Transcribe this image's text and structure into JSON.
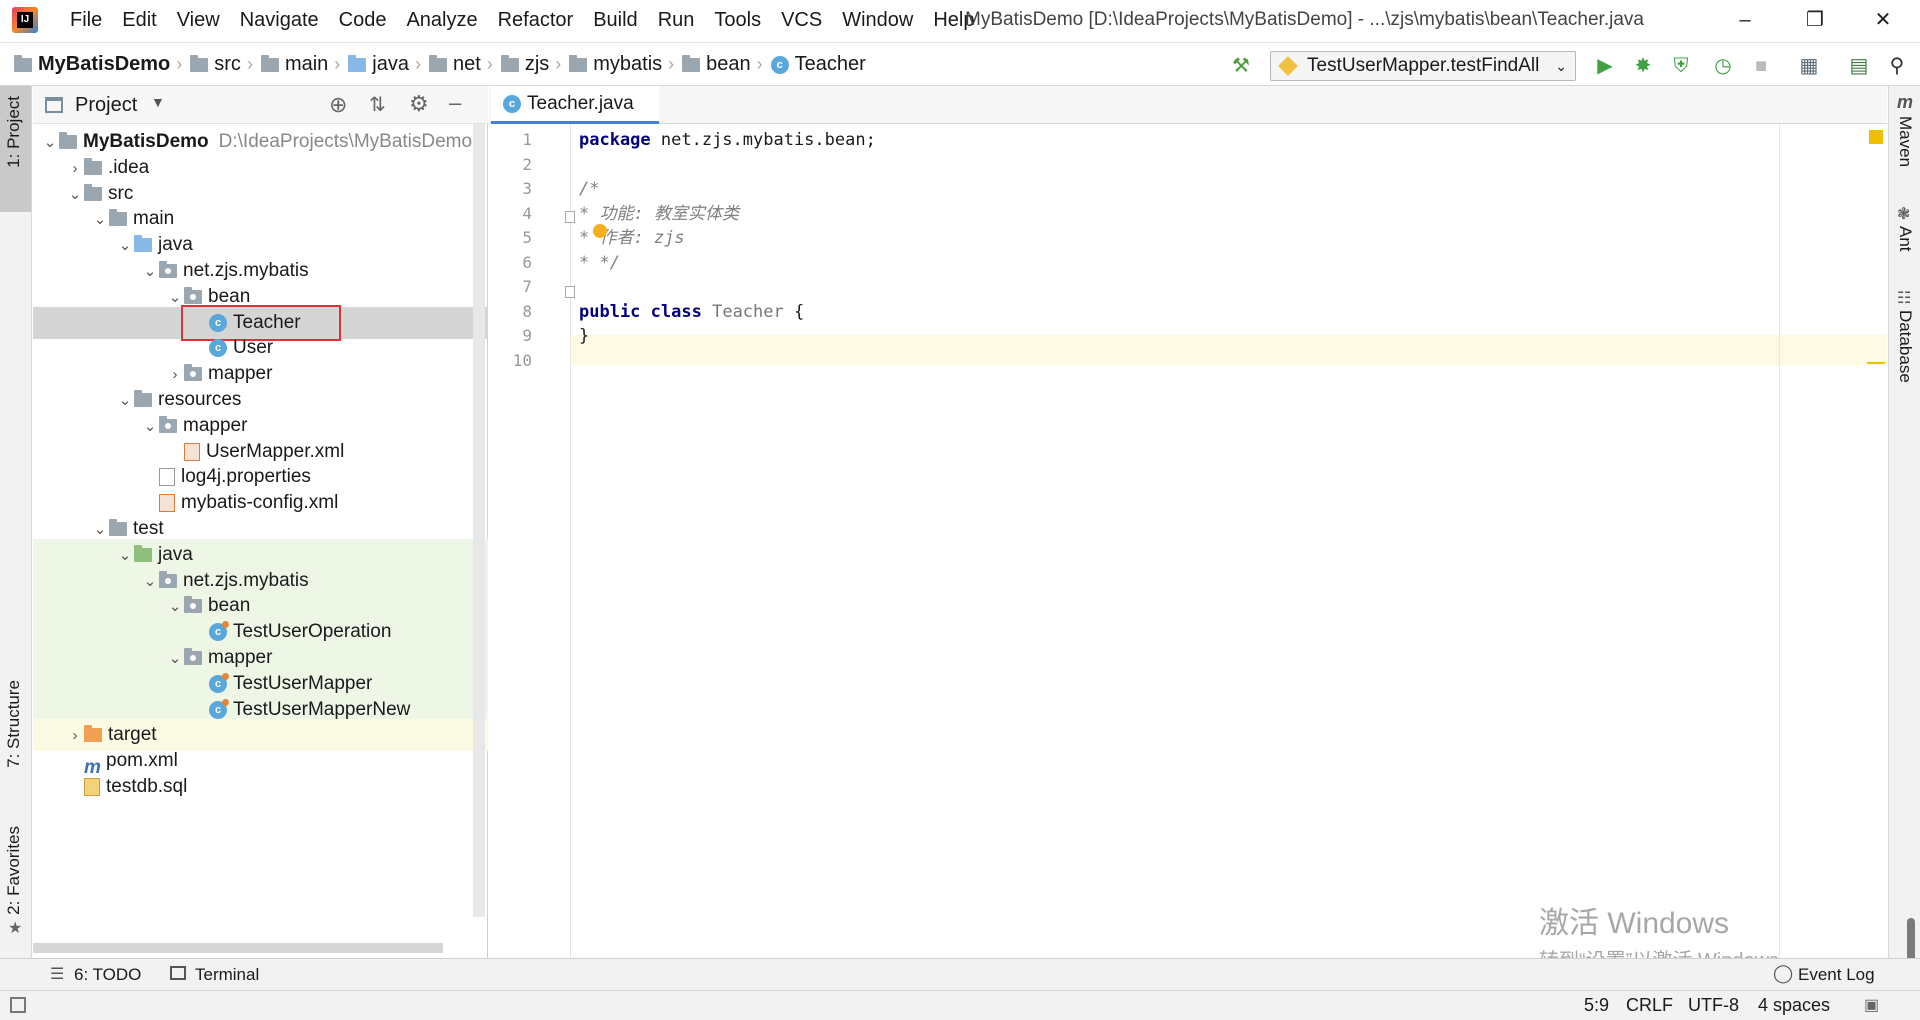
{
  "window": {
    "title": "MyBatisDemo [D:\\IdeaProjects\\MyBatisDemo] - ...\\zjs\\mybatis\\bean\\Teacher.java",
    "menu": [
      "File",
      "Edit",
      "View",
      "Navigate",
      "Code",
      "Analyze",
      "Refactor",
      "Build",
      "Run",
      "Tools",
      "VCS",
      "Window",
      "Help"
    ]
  },
  "breadcrumb": [
    "MyBatisDemo",
    "src",
    "main",
    "java",
    "net",
    "zjs",
    "mybatis",
    "bean",
    "Teacher"
  ],
  "run_config": "TestUserMapper.testFindAll",
  "left_tabs": [
    "1: Project",
    "7: Structure",
    "2: Favorites"
  ],
  "right_tabs": [
    "Maven",
    "Ant",
    "Database"
  ],
  "project_panel": {
    "title": "Project",
    "tree": [
      {
        "label": "MyBatisDemo",
        "extra": "D:\\IdeaProjects\\MyBatisDemo",
        "depth": 0,
        "arrow": "down",
        "icon": "project-folder-icon"
      },
      {
        "label": ".idea",
        "depth": 1,
        "arrow": "right",
        "icon": "folder-icon"
      },
      {
        "label": "src",
        "depth": 1,
        "arrow": "down",
        "icon": "folder-icon"
      },
      {
        "label": "main",
        "depth": 2,
        "arrow": "down",
        "icon": "folder-icon"
      },
      {
        "label": "java",
        "depth": 3,
        "arrow": "down",
        "icon": "source-folder-icon"
      },
      {
        "label": "net.zjs.mybatis",
        "depth": 4,
        "arrow": "down",
        "icon": "package-icon"
      },
      {
        "label": "bean",
        "depth": 5,
        "arrow": "down",
        "icon": "package-icon"
      },
      {
        "label": "Teacher",
        "depth": 6,
        "arrow": "",
        "icon": "class-icon",
        "selected": true
      },
      {
        "label": "User",
        "depth": 6,
        "arrow": "",
        "icon": "class-icon"
      },
      {
        "label": "mapper",
        "depth": 5,
        "arrow": "right",
        "icon": "package-icon"
      },
      {
        "label": "resources",
        "depth": 3,
        "arrow": "down",
        "icon": "resources-folder-icon"
      },
      {
        "label": "mapper",
        "depth": 4,
        "arrow": "down",
        "icon": "package-icon"
      },
      {
        "label": "UserMapper.xml",
        "depth": 5,
        "arrow": "",
        "icon": "xml-file-icon"
      },
      {
        "label": "log4j.properties",
        "depth": 4,
        "arrow": "",
        "icon": "properties-file-icon"
      },
      {
        "label": "mybatis-config.xml",
        "depth": 4,
        "arrow": "",
        "icon": "xml-file-icon"
      },
      {
        "label": "test",
        "depth": 2,
        "arrow": "down",
        "icon": "folder-icon"
      },
      {
        "label": "java",
        "depth": 3,
        "arrow": "down",
        "icon": "test-folder-icon",
        "green": true
      },
      {
        "label": "net.zjs.mybatis",
        "depth": 4,
        "arrow": "down",
        "icon": "package-icon",
        "green": true
      },
      {
        "label": "bean",
        "depth": 5,
        "arrow": "down",
        "icon": "package-icon",
        "green": true
      },
      {
        "label": "TestUserOperation",
        "depth": 6,
        "arrow": "",
        "icon": "test-class-icon",
        "green": true
      },
      {
        "label": "mapper",
        "depth": 5,
        "arrow": "down",
        "icon": "package-icon",
        "green": true
      },
      {
        "label": "TestUserMapper",
        "depth": 6,
        "arrow": "",
        "icon": "test-class-icon",
        "green": true
      },
      {
        "label": "TestUserMapperNew",
        "depth": 6,
        "arrow": "",
        "icon": "test-class-icon",
        "green": true
      },
      {
        "label": "target",
        "depth": 1,
        "arrow": "right",
        "icon": "excluded-folder-icon",
        "yellow": true
      },
      {
        "label": "pom.xml",
        "depth": 1,
        "arrow": "",
        "icon": "maven-file-icon"
      },
      {
        "label": "testdb.sql",
        "depth": 1,
        "arrow": "",
        "icon": "sql-file-icon"
      }
    ]
  },
  "editor": {
    "tab_label": "Teacher.java",
    "line_numbers": [
      "1",
      "2",
      "3",
      "4",
      "5",
      "6",
      "7",
      "8",
      "9",
      "10"
    ],
    "lines": [
      [
        {
          "t": "package",
          "c": "kw"
        },
        {
          "t": " net.zjs.mybatis.bean;",
          "c": ""
        }
      ],
      [],
      [
        {
          "t": "/*",
          "c": "cm"
        }
      ],
      [
        {
          "t": "* 功能: 教室实体类",
          "c": "cm"
        }
      ],
      [
        {
          "t": "* 作者: zjs",
          "c": "cm"
        }
      ],
      [
        {
          "t": "* */",
          "c": "cm"
        }
      ],
      [],
      [
        {
          "t": "public",
          "c": "kw"
        },
        {
          "t": " ",
          "c": ""
        },
        {
          "t": "class",
          "c": "kw"
        },
        {
          "t": " Teacher",
          "c": "cls"
        },
        {
          "t": " {",
          "c": ""
        }
      ],
      [
        {
          "t": "}",
          "c": ""
        }
      ],
      []
    ]
  },
  "bottom_tabs": {
    "todo": "6: TODO",
    "terminal": "Terminal",
    "event_log": "Event Log"
  },
  "status": {
    "position": "5:9",
    "line_sep": "CRLF",
    "encoding": "UTF-8",
    "indent": "4 spaces"
  },
  "watermark": {
    "line1": "激活 Windows",
    "line2": "转到“设置”以激活 Windows。"
  }
}
